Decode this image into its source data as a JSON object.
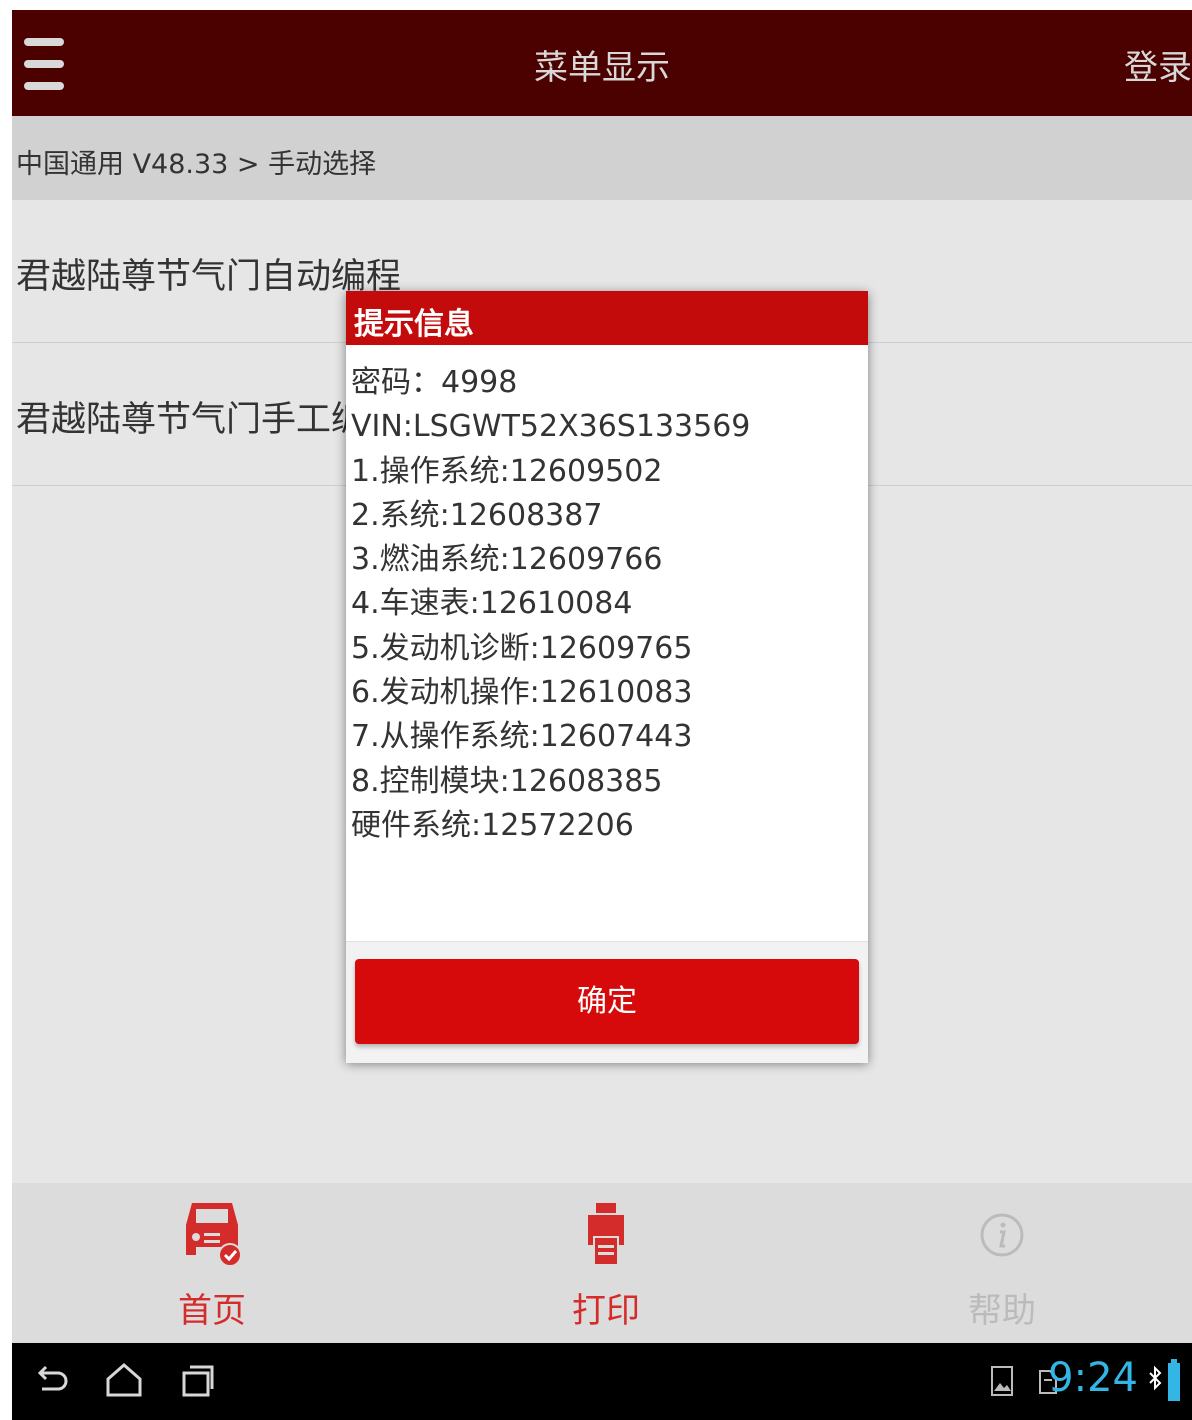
{
  "header": {
    "title": "菜单显示",
    "login_label": "登录"
  },
  "breadcrumb": {
    "text": "中国通用 V48.33 > 手动选择"
  },
  "menu_items": [
    {
      "label": "君越陆尊节气门自动编程"
    },
    {
      "label": "君越陆尊节气门手工编程"
    }
  ],
  "dialog": {
    "title": "提示信息",
    "lines": [
      "密码：4998",
      "VIN:LSGWT52X36S133569",
      "1.操作系统:12609502",
      "2.系统:12608387",
      "3.燃油系统:12609766",
      "4.车速表:12610084",
      "5.发动机诊断:12609765",
      "6.发动机操作:12610083",
      "7.从操作系统:12607443",
      "8.控制模块:12608385",
      "硬件系统:12572206"
    ],
    "ok_label": "确定"
  },
  "bottom_nav": [
    {
      "label": "首页",
      "icon": "car-icon",
      "color": "#d42b2b"
    },
    {
      "label": "打印",
      "icon": "printer-icon",
      "color": "#d42b2b"
    },
    {
      "label": "帮助",
      "icon": "info-icon",
      "color": "#bbbbbb"
    }
  ],
  "system_bar": {
    "time": "9:24"
  },
  "colors": {
    "title_bar": "#4a0100",
    "dialog_header": "#c40b0b",
    "ok_button": "#d60a0a",
    "clock": "#33b5e5"
  }
}
